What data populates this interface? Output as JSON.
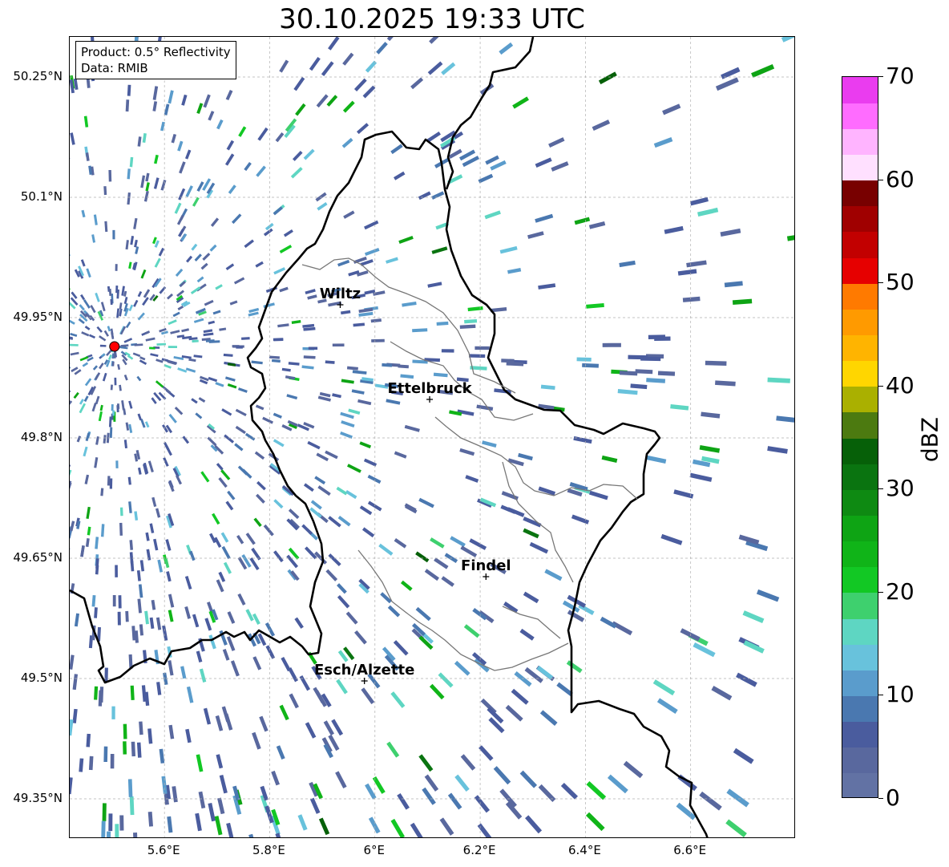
{
  "title": "30.10.2025 19:33 UTC",
  "info": {
    "product": "Product: 0.5° Reflectivity",
    "source": "Data: RMIB"
  },
  "map": {
    "lon_range": [
      5.42,
      6.8
    ],
    "lat_range": [
      49.3,
      50.3
    ],
    "lat_ticks": [
      {
        "value": 50.25,
        "label": "50.25°N"
      },
      {
        "value": 50.1,
        "label": "50.1°N"
      },
      {
        "value": 49.95,
        "label": "49.95°N"
      },
      {
        "value": 49.8,
        "label": "49.8°N"
      },
      {
        "value": 49.65,
        "label": "49.65°N"
      },
      {
        "value": 49.5,
        "label": "49.5°N"
      },
      {
        "value": 49.35,
        "label": "49.35°N"
      }
    ],
    "lon_ticks": [
      {
        "value": 5.6,
        "label": "5.6°E"
      },
      {
        "value": 5.8,
        "label": "5.8°E"
      },
      {
        "value": 6.0,
        "label": "6°E"
      },
      {
        "value": 6.2,
        "label": "6.2°E"
      },
      {
        "value": 6.4,
        "label": "6.4°E"
      },
      {
        "value": 6.6,
        "label": "6.6°E"
      }
    ],
    "radar_site": {
      "lon": 5.505,
      "lat": 49.914,
      "color": "#ff0000"
    },
    "cities": [
      {
        "name": "Wiltz",
        "lon": 5.934,
        "lat": 49.966
      },
      {
        "name": "Ettelbruck",
        "lon": 6.104,
        "lat": 49.848
      },
      {
        "name": "Findel",
        "lon": 6.211,
        "lat": 49.627
      },
      {
        "name": "Esch/Alzette",
        "lon": 5.98,
        "lat": 49.497
      }
    ]
  },
  "colorbar": {
    "label": "dBZ",
    "min": 0,
    "max": 70,
    "ticks": [
      {
        "value": 0,
        "label": "0"
      },
      {
        "value": 10,
        "label": "10"
      },
      {
        "value": 20,
        "label": "20"
      },
      {
        "value": 30,
        "label": "30"
      },
      {
        "value": 40,
        "label": "40"
      },
      {
        "value": 50,
        "label": "50"
      },
      {
        "value": 60,
        "label": "60"
      },
      {
        "value": 70,
        "label": "70"
      }
    ],
    "colors": [
      "#6272a4",
      "#59689e",
      "#4a5c9e",
      "#4a78b0",
      "#5a9ccc",
      "#68c2dc",
      "#5ed6c2",
      "#3ed06e",
      "#12c824",
      "#10b418",
      "#0ea414",
      "#0e8a12",
      "#0a7410",
      "#066008",
      "#4c7a10",
      "#aab000",
      "#ffd600",
      "#ffb400",
      "#ff9a00",
      "#ff7a00",
      "#e60000",
      "#c20000",
      "#a00000",
      "#780000",
      "#ffe0ff",
      "#ffb4ff",
      "#ff6cff",
      "#ea3cef"
    ]
  }
}
